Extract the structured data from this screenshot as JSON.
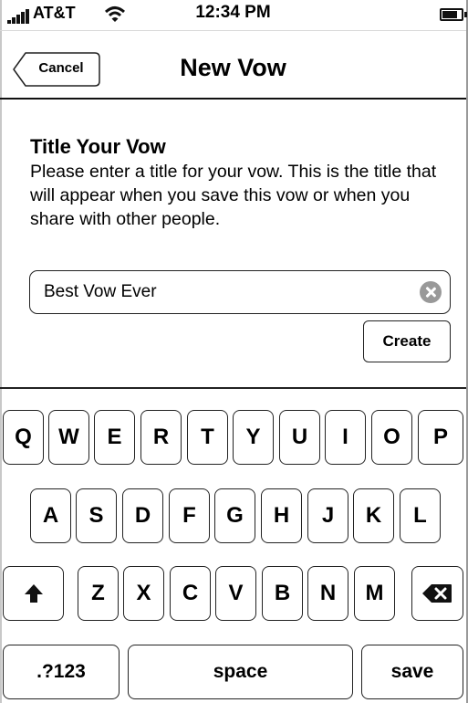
{
  "status_bar": {
    "carrier": "AT&T",
    "time": "12:34 PM"
  },
  "nav": {
    "cancel_label": "Cancel",
    "title": "New Vow"
  },
  "form": {
    "heading": "Title Your Vow",
    "description": "Please enter a title for your vow. This is the title that will appear when you save this vow or when you share with other people.",
    "title_value": "Best Vow Ever",
    "create_label": "Create"
  },
  "keyboard": {
    "row1": [
      "Q",
      "W",
      "E",
      "R",
      "T",
      "Y",
      "U",
      "I",
      "O",
      "P"
    ],
    "row2": [
      "A",
      "S",
      "D",
      "F",
      "G",
      "H",
      "J",
      "K",
      "L"
    ],
    "row3": [
      "Z",
      "X",
      "C",
      "V",
      "B",
      "N",
      "M"
    ],
    "numbers_label": ".?123",
    "space_label": "space",
    "save_label": "save",
    "icons": {
      "shift": "shift-arrow-up-icon",
      "delete": "backspace-icon"
    }
  }
}
